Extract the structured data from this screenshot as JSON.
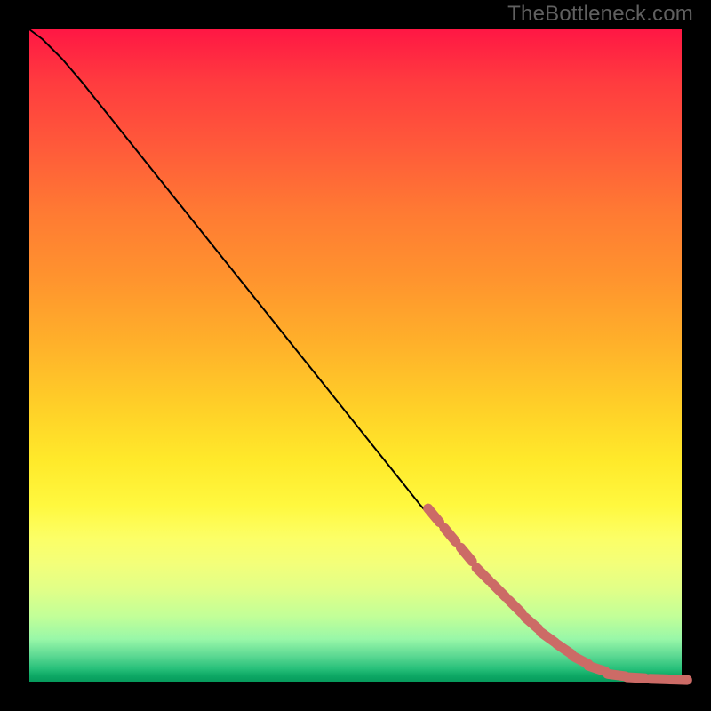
{
  "watermark": "TheBottleneck.com",
  "chart_data": {
    "type": "line",
    "title": "",
    "xlabel": "",
    "ylabel": "",
    "xlim": [
      0,
      1
    ],
    "ylim": [
      0,
      1
    ],
    "series": [
      {
        "name": "curve",
        "style": "solid-black",
        "points": [
          {
            "x": 0.0,
            "y": 1.0
          },
          {
            "x": 0.02,
            "y": 0.985
          },
          {
            "x": 0.05,
            "y": 0.955
          },
          {
            "x": 0.08,
            "y": 0.92
          },
          {
            "x": 0.12,
            "y": 0.87
          },
          {
            "x": 0.2,
            "y": 0.77
          },
          {
            "x": 0.3,
            "y": 0.645
          },
          {
            "x": 0.4,
            "y": 0.52
          },
          {
            "x": 0.5,
            "y": 0.395
          },
          {
            "x": 0.6,
            "y": 0.27
          },
          {
            "x": 0.7,
            "y": 0.16
          },
          {
            "x": 0.78,
            "y": 0.085
          },
          {
            "x": 0.84,
            "y": 0.035
          },
          {
            "x": 0.88,
            "y": 0.012
          },
          {
            "x": 0.92,
            "y": 0.004
          },
          {
            "x": 0.96,
            "y": 0.002
          },
          {
            "x": 1.0,
            "y": 0.002
          }
        ]
      },
      {
        "name": "lower-segment-markers",
        "style": "thick-salmon-dashed",
        "points": [
          {
            "x": 0.62,
            "y": 0.255
          },
          {
            "x": 0.645,
            "y": 0.225
          },
          {
            "x": 0.67,
            "y": 0.195
          },
          {
            "x": 0.695,
            "y": 0.165
          },
          {
            "x": 0.72,
            "y": 0.14
          },
          {
            "x": 0.745,
            "y": 0.115
          },
          {
            "x": 0.77,
            "y": 0.09
          },
          {
            "x": 0.795,
            "y": 0.068
          },
          {
            "x": 0.82,
            "y": 0.05
          },
          {
            "x": 0.845,
            "y": 0.033
          },
          {
            "x": 0.87,
            "y": 0.02
          },
          {
            "x": 0.9,
            "y": 0.01
          },
          {
            "x": 0.93,
            "y": 0.006
          },
          {
            "x": 0.965,
            "y": 0.004
          },
          {
            "x": 0.995,
            "y": 0.003
          }
        ]
      }
    ]
  }
}
